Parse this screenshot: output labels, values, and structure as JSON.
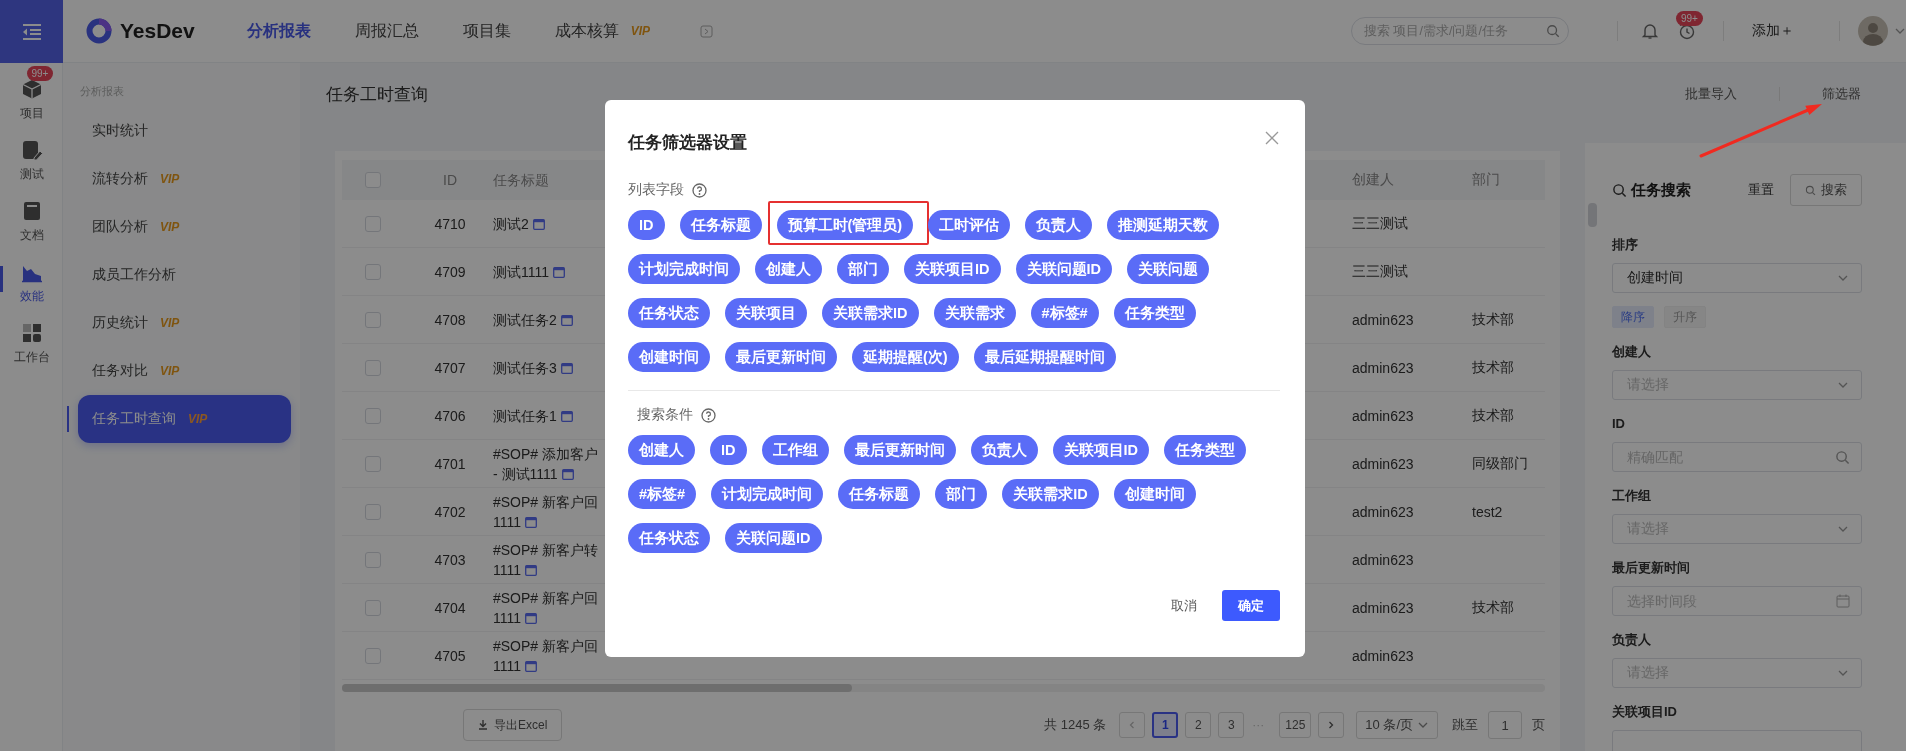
{
  "rail": {
    "items": [
      {
        "label": "项目",
        "badge": "99+",
        "selected": false
      },
      {
        "label": "测试",
        "selected": false
      },
      {
        "label": "文档",
        "selected": false
      },
      {
        "label": "效能",
        "selected": true
      },
      {
        "label": "工作台",
        "selected": false
      }
    ]
  },
  "topbar": {
    "logo": "YesDev",
    "nav": [
      {
        "label": "分析报表",
        "selected": true
      },
      {
        "label": "周报汇总",
        "selected": false
      },
      {
        "label": "项目集",
        "selected": false
      },
      {
        "label": "成本核算",
        "vip": "VIP",
        "selected": false
      }
    ],
    "search": {
      "placeholder": "搜索 项目/需求/问题/任务"
    },
    "alarm_badge": "99+",
    "add": "添加＋"
  },
  "sidebar": {
    "heading": "分析报表",
    "items": [
      {
        "label": "实时统计",
        "selected": false
      },
      {
        "label": "流转分析",
        "vip": "VIP",
        "selected": false
      },
      {
        "label": "团队分析",
        "vip": "VIP",
        "selected": false
      },
      {
        "label": "成员工作分析",
        "selected": false
      },
      {
        "label": "历史统计",
        "vip": "VIP",
        "selected": false
      },
      {
        "label": "任务对比",
        "vip": "VIP",
        "selected": false
      },
      {
        "label": "任务工时查询",
        "vip": "VIP",
        "selected": true
      }
    ]
  },
  "page": {
    "title": "任务工时查询",
    "actions": [
      "批量导入",
      "筛选器"
    ]
  },
  "table": {
    "header_checked": false,
    "columns": [
      "ID",
      "任务标题",
      "创建人",
      "部门"
    ],
    "rows": [
      {
        "checked": false,
        "id": "4710",
        "title": [
          "测试2"
        ],
        "creator": "三三测试"
      },
      {
        "checked": false,
        "id": "4709",
        "title": [
          "测试1111"
        ],
        "creator": "三三测试"
      },
      {
        "checked": false,
        "id": "4708",
        "title": [
          "测试任务2"
        ],
        "creator": "admin623",
        "dept": "技术部"
      },
      {
        "checked": false,
        "id": "4707",
        "title": [
          "测试任务3"
        ],
        "creator": "admin623",
        "dept": "技术部"
      },
      {
        "checked": false,
        "id": "4706",
        "title": [
          "测试任务1"
        ],
        "creator": "admin623",
        "dept": "技术部"
      },
      {
        "checked": false,
        "id": "4701",
        "title": [
          "#SOP# 添加客户",
          "- 测试1111"
        ],
        "creator": "admin623",
        "dept": "同级部门"
      },
      {
        "checked": false,
        "id": "4702",
        "title": [
          "#SOP# 新客户回",
          "1111"
        ],
        "creator": "admin623",
        "dept": "test2"
      },
      {
        "checked": false,
        "id": "4703",
        "title": [
          "#SOP# 新客户转",
          "1111"
        ],
        "creator": "admin623"
      },
      {
        "checked": false,
        "id": "4704",
        "title": [
          "#SOP# 新客户回",
          "1111"
        ],
        "creator": "admin623",
        "dept": "技术部"
      },
      {
        "checked": false,
        "id": "4705",
        "title": [
          "#SOP# 新客户回",
          "1111"
        ],
        "creator": "admin623"
      }
    ]
  },
  "pagination": {
    "export": "导出Excel",
    "total": "共 1245 条",
    "pages": [
      {
        "label": "1",
        "kind": "page",
        "selected": true
      },
      {
        "label": "2",
        "kind": "page",
        "selected": false
      },
      {
        "label": "3",
        "kind": "page",
        "selected": false
      },
      {
        "label": "···",
        "kind": "ellipsis"
      },
      {
        "label": "125",
        "kind": "page",
        "selected": false
      }
    ],
    "page_size": "10 条/页",
    "jump_label": "跳至",
    "jump_value": "1",
    "jump_suffix": "页"
  },
  "filter_panel": {
    "title": "任务搜索",
    "reset": "重置",
    "search": "搜索",
    "sort": {
      "label": "排序",
      "value": "创建时间",
      "orders": [
        {
          "label": "降序",
          "selected": true
        },
        {
          "label": "升序",
          "selected": false
        }
      ]
    },
    "fields": [
      {
        "label": "创建人",
        "kind": "select",
        "placeholder": "请选择"
      },
      {
        "label": "ID",
        "kind": "search",
        "placeholder": "精确匹配"
      },
      {
        "label": "工作组",
        "kind": "select",
        "placeholder": "请选择"
      },
      {
        "label": "最后更新时间",
        "kind": "date",
        "placeholder": "选择时间段"
      },
      {
        "label": "负责人",
        "kind": "select",
        "placeholder": "请选择"
      },
      {
        "label": "关联项目ID",
        "kind": "search"
      }
    ]
  },
  "modal": {
    "title": "任务筛选器设置",
    "sections": [
      {
        "label": "列表字段",
        "chips": [
          {
            "label": "ID",
            "highlighted": false
          },
          {
            "label": "任务标题",
            "highlighted": false
          },
          {
            "label": "预算工时(管理员)",
            "highlighted": true
          },
          {
            "label": "工时评估",
            "highlighted": false
          },
          {
            "label": "负责人",
            "highlighted": false
          },
          {
            "label": "推测延期天数",
            "highlighted": false
          },
          {
            "label": "计划完成时间",
            "highlighted": false
          },
          {
            "label": "创建人",
            "highlighted": false
          },
          {
            "label": "部门",
            "highlighted": false
          },
          {
            "label": "关联项目ID",
            "highlighted": false
          },
          {
            "label": "关联问题ID",
            "highlighted": false
          },
          {
            "label": "关联问题",
            "highlighted": false
          },
          {
            "label": "任务状态",
            "highlighted": false
          },
          {
            "label": "关联项目",
            "highlighted": false
          },
          {
            "label": "关联需求ID",
            "highlighted": false
          },
          {
            "label": "关联需求",
            "highlighted": false
          },
          {
            "label": "#标签#",
            "highlighted": false
          },
          {
            "label": "任务类型",
            "highlighted": false
          },
          {
            "label": "创建时间",
            "highlighted": false
          },
          {
            "label": "最后更新时间",
            "highlighted": false
          },
          {
            "label": "延期提醒(次)",
            "highlighted": false
          },
          {
            "label": "最后延期提醒时间",
            "highlighted": false
          }
        ]
      },
      {
        "label": "搜索条件",
        "chips": [
          {
            "label": "创建人",
            "highlighted": false
          },
          {
            "label": "ID",
            "highlighted": false
          },
          {
            "label": "工作组",
            "highlighted": false
          },
          {
            "label": "最后更新时间",
            "highlighted": false
          },
          {
            "label": "负责人",
            "highlighted": false
          },
          {
            "label": "关联项目ID",
            "highlighted": false
          },
          {
            "label": "任务类型",
            "highlighted": false
          },
          {
            "label": "#标签#",
            "highlighted": false
          },
          {
            "label": "计划完成时间",
            "highlighted": false
          },
          {
            "label": "任务标题",
            "highlighted": false
          },
          {
            "label": "部门",
            "highlighted": false
          },
          {
            "label": "关联需求ID",
            "highlighted": false
          },
          {
            "label": "创建时间",
            "highlighted": false
          },
          {
            "label": "任务状态",
            "highlighted": false
          },
          {
            "label": "关联问题ID",
            "highlighted": false
          }
        ]
      }
    ],
    "cancel": "取消",
    "ok": "确定"
  }
}
